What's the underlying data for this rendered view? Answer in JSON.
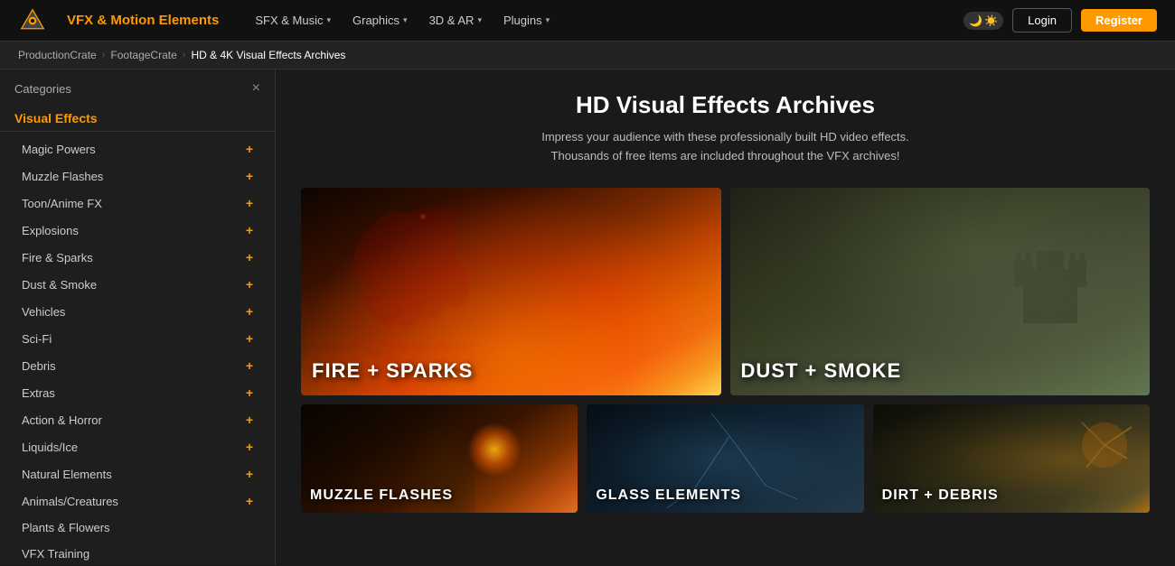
{
  "navbar": {
    "brand": "VFX & Motion Elements",
    "links": [
      {
        "label": "SFX & Music",
        "hasDropdown": true
      },
      {
        "label": "Graphics",
        "hasDropdown": true
      },
      {
        "label": "3D & AR",
        "hasDropdown": true
      },
      {
        "label": "Plugins",
        "hasDropdown": true
      }
    ],
    "login_label": "Login",
    "register_label": "Register"
  },
  "breadcrumb": {
    "items": [
      {
        "label": "ProductionCrate",
        "link": true
      },
      {
        "label": "FootageCrate",
        "link": true
      },
      {
        "label": "HD & 4K Visual Effects Archives",
        "active": true
      }
    ]
  },
  "sidebar": {
    "header": "Categories",
    "close_label": "×",
    "section_title": "Visual Effects",
    "items": [
      {
        "label": "Magic Powers",
        "plus": "+"
      },
      {
        "label": "Muzzle Flashes",
        "plus": "+"
      },
      {
        "label": "Toon/Anime FX",
        "plus": "+"
      },
      {
        "label": "Explosions",
        "plus": "+"
      },
      {
        "label": "Fire & Sparks",
        "plus": "+"
      },
      {
        "label": "Dust & Smoke",
        "plus": "+"
      },
      {
        "label": "Vehicles",
        "plus": "+"
      },
      {
        "label": "Sci-Fi",
        "plus": "+"
      },
      {
        "label": "Debris",
        "plus": "+"
      },
      {
        "label": "Extras",
        "plus": "+"
      },
      {
        "label": "Action & Horror",
        "plus": "+"
      },
      {
        "label": "Liquids/Ice",
        "plus": "+"
      },
      {
        "label": "Natural Elements",
        "plus": "+"
      },
      {
        "label": "Animals/Creatures",
        "plus": "+"
      },
      {
        "label": "Plants & Flowers"
      },
      {
        "label": "VFX Training"
      }
    ]
  },
  "content": {
    "title": "HD Visual Effects Archives",
    "subtitle": "Impress your audience with these professionally built HD video effects.\nThousands of free items are included throughout the VFX archives!",
    "cards_row1": [
      {
        "label": "FIRE + SPARKS",
        "type": "fire"
      },
      {
        "label": "DUST + SMOKE",
        "type": "dust"
      }
    ],
    "cards_row2": [
      {
        "label": "MUZZLE FLASHES",
        "type": "muzzle"
      },
      {
        "label": "GLASS ELEMENTS",
        "type": "glass"
      },
      {
        "label": "DIRT + DEBRIS",
        "type": "debris"
      }
    ]
  },
  "colors": {
    "accent": "#f90",
    "brand": "#f90"
  }
}
